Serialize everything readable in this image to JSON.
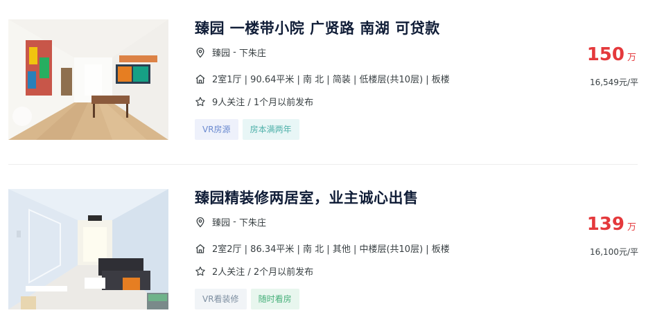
{
  "listings": [
    {
      "title": "臻园 一楼带小院 广贤路 南湖 可贷款",
      "community": "臻园",
      "separator": " - ",
      "area": "下朱庄",
      "house_info": "2室1厅 | 90.64平米 | 南 北 | 简装 | 低楼层(共10层) | 板楼",
      "follow_info": "9人关注 / 1个月以前发布",
      "tags": [
        {
          "label": "VR房源",
          "bg": "#eef1fb",
          "color": "#6b8ad0"
        },
        {
          "label": "房本满两年",
          "bg": "#e8f6f6",
          "color": "#4fb1aa"
        }
      ],
      "total_price": "150",
      "total_unit": "万",
      "unit_price": "16,549元/平",
      "icons": {
        "location": "location-pin-icon",
        "house": "house-icon",
        "follow": "star-icon"
      }
    },
    {
      "title": "臻园精装修两居室，业主诚心出售",
      "community": "臻园",
      "separator": " - ",
      "area": "下朱庄",
      "house_info": "2室2厅 | 86.34平米 | 南 北 | 其他 | 中楼层(共10层) | 板楼",
      "follow_info": "2人关注 / 2个月以前发布",
      "tags": [
        {
          "label": "VR看装修",
          "bg": "#f1f4f7",
          "color": "#7d8ea0"
        },
        {
          "label": "随时看房",
          "bg": "#e8f6ee",
          "color": "#47b07a"
        }
      ],
      "total_price": "139",
      "total_unit": "万",
      "unit_price": "16,100元/平",
      "icons": {
        "location": "location-pin-icon",
        "house": "house-icon",
        "follow": "star-icon"
      }
    }
  ],
  "colors": {
    "price": "#e4393c",
    "title": "#101d37",
    "text": "#394043"
  }
}
